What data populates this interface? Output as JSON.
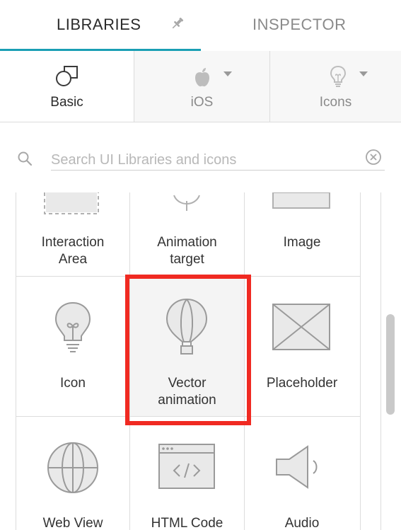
{
  "tabs": {
    "libraries": "LIBRARIES",
    "inspector": "INSPECTOR"
  },
  "library_tabs": {
    "basic": "Basic",
    "ios": "iOS",
    "icons": "Icons"
  },
  "search": {
    "placeholder": "Search UI Libraries and icons",
    "value": ""
  },
  "items": {
    "interaction_area": [
      "Interaction",
      "Area"
    ],
    "animation_target": [
      "Animation",
      "target"
    ],
    "image": [
      "Image"
    ],
    "icon": [
      "Icon"
    ],
    "vector_animation": [
      "Vector",
      "animation"
    ],
    "placeholder": [
      "Placeholder"
    ],
    "web_view": [
      "Web View"
    ],
    "html_code": [
      "HTML Code"
    ],
    "audio": [
      "Audio"
    ]
  },
  "colors": {
    "accent": "#1a9fb4",
    "highlight": "#f02a22",
    "icon_gray": "#9a9a9a",
    "icon_fill": "#e9e9e9"
  },
  "icons": {
    "pin": "pin-icon",
    "basic": "shapes-icon",
    "ios": "apple-icon",
    "icons": "lightbulb-icon",
    "search": "search-icon",
    "clear": "clear-icon"
  }
}
